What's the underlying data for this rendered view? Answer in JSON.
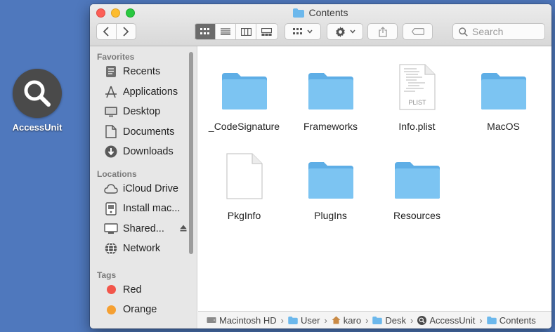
{
  "desktop": {
    "app_label": "AccessUnit"
  },
  "window": {
    "title": "Contents",
    "search_placeholder": "Search"
  },
  "sidebar": {
    "favorites_header": "Favorites",
    "favorites": [
      {
        "label": "Recents",
        "icon": "clock-icon"
      },
      {
        "label": "Applications",
        "icon": "applications-icon"
      },
      {
        "label": "Desktop",
        "icon": "desktop-icon"
      },
      {
        "label": "Documents",
        "icon": "document-icon"
      },
      {
        "label": "Downloads",
        "icon": "download-icon"
      }
    ],
    "locations_header": "Locations",
    "locations": [
      {
        "label": "iCloud Drive",
        "icon": "cloud-icon"
      },
      {
        "label": "Install mac...",
        "icon": "disk-icon"
      },
      {
        "label": "Shared...",
        "icon": "display-icon"
      },
      {
        "label": "Network",
        "icon": "globe-icon"
      }
    ],
    "tags_header": "Tags",
    "tags": [
      {
        "label": "Red",
        "color": "#f2564b"
      },
      {
        "label": "Orange",
        "color": "#f5a032"
      }
    ]
  },
  "files": [
    {
      "name": "_CodeSignature",
      "type": "folder"
    },
    {
      "name": "Frameworks",
      "type": "folder"
    },
    {
      "name": "Info.plist",
      "type": "plist",
      "badge": "PLIST"
    },
    {
      "name": "MacOS",
      "type": "folder"
    },
    {
      "name": "PkgInfo",
      "type": "document"
    },
    {
      "name": "PlugIns",
      "type": "folder"
    },
    {
      "name": "Resources",
      "type": "folder"
    }
  ],
  "pathbar": [
    {
      "label": "Macintosh HD",
      "icon": "harddrive-icon"
    },
    {
      "label": "User",
      "icon": "folder-icon"
    },
    {
      "label": "karo",
      "icon": "home-icon"
    },
    {
      "label": "Desk",
      "icon": "folder-icon"
    },
    {
      "label": "AccessUnit",
      "icon": "app-icon"
    },
    {
      "label": "Contents",
      "icon": "folder-icon"
    }
  ],
  "colors": {
    "folder": "#6cb8ec",
    "desktop_bg": "#4f78bd"
  }
}
